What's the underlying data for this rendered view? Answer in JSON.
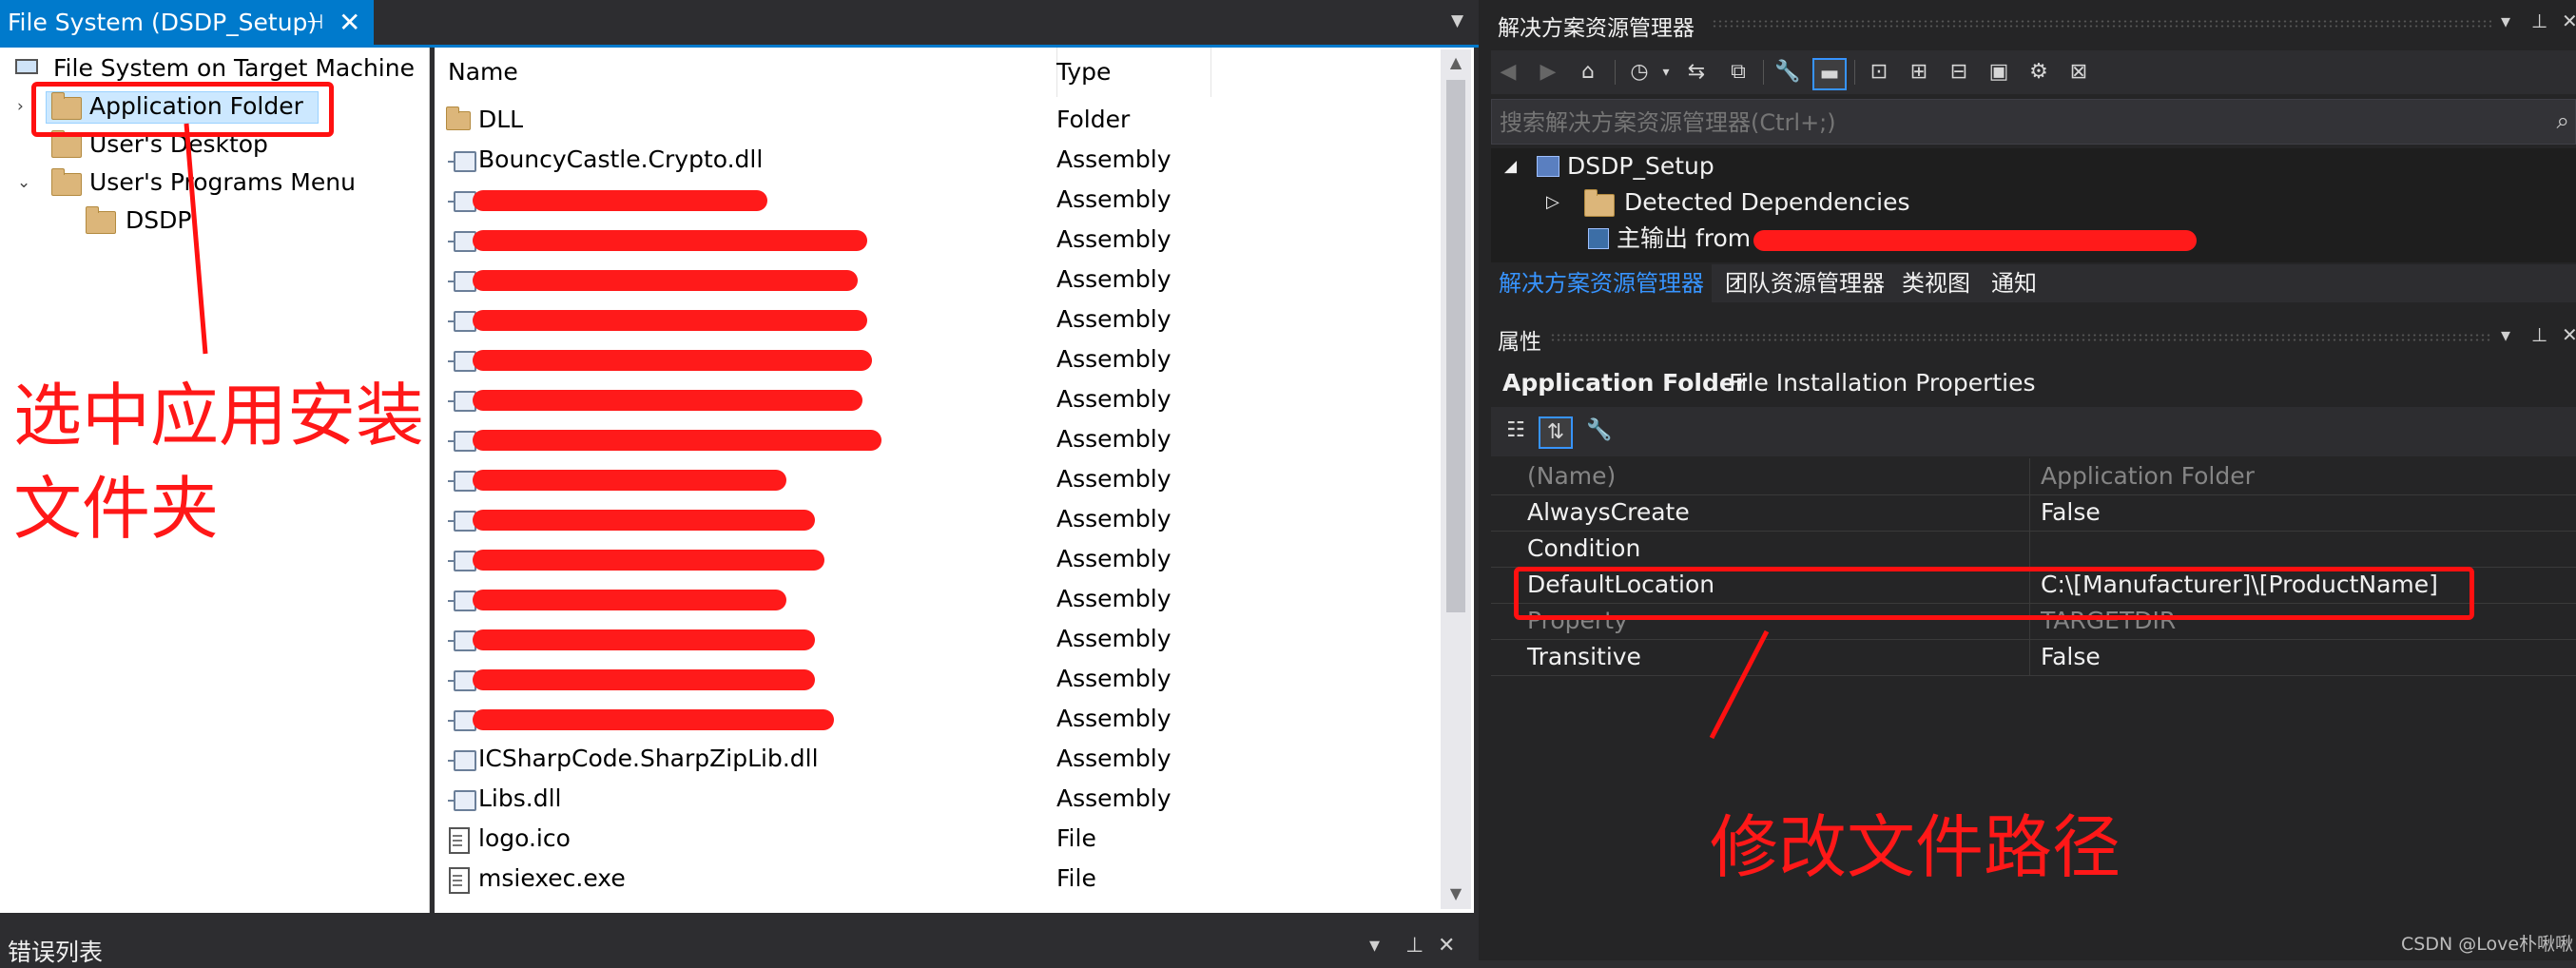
{
  "document_tab": {
    "title": "File System (DSDP_Setup)",
    "pin": "⊣",
    "close": "✕"
  },
  "file_tree": {
    "root": "File System on Target Machine",
    "items": [
      {
        "label": "Application Folder",
        "selected": true
      },
      {
        "label": "User's Desktop"
      },
      {
        "label": "User's Programs Menu",
        "expanded": true
      },
      {
        "label": "DSDP",
        "child": true
      }
    ]
  },
  "file_list": {
    "columns": [
      "Name",
      "Type"
    ],
    "rows": [
      {
        "name": "DLL",
        "type": "Folder",
        "icon": "folder"
      },
      {
        "name": "BouncyCastle.Crypto.dll",
        "type": "Assembly",
        "icon": "assembly"
      },
      {
        "name": "",
        "type": "Assembly",
        "icon": "assembly",
        "redacted": true
      },
      {
        "name": "",
        "type": "Assembly",
        "icon": "assembly",
        "redacted": true
      },
      {
        "name": "",
        "type": "Assembly",
        "icon": "assembly",
        "redacted": true
      },
      {
        "name": "",
        "type": "Assembly",
        "icon": "assembly",
        "redacted": true
      },
      {
        "name": "",
        "type": "Assembly",
        "icon": "assembly",
        "redacted": true
      },
      {
        "name": "",
        "type": "Assembly",
        "icon": "assembly",
        "redacted": true
      },
      {
        "name": "",
        "type": "Assembly",
        "icon": "assembly",
        "redacted": true
      },
      {
        "name": "",
        "type": "Assembly",
        "icon": "assembly",
        "redacted": true
      },
      {
        "name": "",
        "type": "Assembly",
        "icon": "assembly",
        "redacted": true
      },
      {
        "name": "",
        "type": "Assembly",
        "icon": "assembly",
        "redacted": true
      },
      {
        "name": "",
        "type": "Assembly",
        "icon": "assembly",
        "redacted": true
      },
      {
        "name": "",
        "type": "Assembly",
        "icon": "assembly",
        "redacted": true
      },
      {
        "name": "",
        "type": "Assembly",
        "icon": "assembly",
        "redacted": true
      },
      {
        "name": "",
        "type": "Assembly",
        "icon": "assembly",
        "redacted": true
      },
      {
        "name": "ICSharpCode.SharpZipLib.dll",
        "type": "Assembly",
        "icon": "assembly"
      },
      {
        "name": "Libs.dll",
        "type": "Assembly",
        "icon": "assembly"
      },
      {
        "name": "logo.ico",
        "type": "File",
        "icon": "file"
      },
      {
        "name": "msiexec.exe",
        "type": "File",
        "icon": "file"
      }
    ]
  },
  "error_list": {
    "title": "错误列表"
  },
  "solution_explorer": {
    "title": "解决方案资源管理器",
    "search_placeholder": "搜索解决方案资源管理器(Ctrl+;)",
    "tree": [
      {
        "label": "DSDP_Setup"
      },
      {
        "label": "Detected Dependencies"
      },
      {
        "label": "主输出 from",
        "redacted": true
      }
    ],
    "tabs": [
      "解决方案资源管理器",
      "团队资源管理器",
      "类视图",
      "通知"
    ]
  },
  "properties": {
    "title": "属性",
    "object_name": "Application Folder",
    "object_type": "File Installation Properties",
    "rows": [
      {
        "key": "(Name)",
        "value": "Application Folder",
        "dim": true
      },
      {
        "key": "AlwaysCreate",
        "value": "False"
      },
      {
        "key": "Condition",
        "value": ""
      },
      {
        "key": "DefaultLocation",
        "value": "C:\\[Manufacturer]\\[ProductName]",
        "highlight": true
      },
      {
        "key": "Property",
        "value": "TARGETDIR",
        "dim": true
      },
      {
        "key": "Transitive",
        "value": "False"
      }
    ]
  },
  "annotations": {
    "select_folder": "选中应用安装\n文件夹",
    "select_folder_line1": "选中应用安装",
    "select_folder_line2": "文件夹",
    "modify_path": "修改文件路径",
    "color": "#ff1010"
  },
  "watermark": "CSDN @Love朴啾啾",
  "icons": [
    "pin-icon",
    "close-icon",
    "folder-icon",
    "assembly-icon",
    "file-icon",
    "search-icon",
    "back-icon",
    "forward-icon",
    "home-icon",
    "history-icon",
    "sync-icon",
    "collapse-icon",
    "properties-wrench-icon",
    "show-all-icon"
  ]
}
